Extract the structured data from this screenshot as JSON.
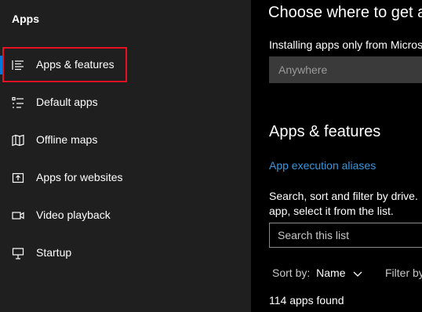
{
  "sidebar": {
    "title": "Apps",
    "items": [
      {
        "label": "Apps & features",
        "icon": "apps-features-icon",
        "selected": true
      },
      {
        "label": "Default apps",
        "icon": "default-apps-icon"
      },
      {
        "label": "Offline maps",
        "icon": "map-icon"
      },
      {
        "label": "Apps for websites",
        "icon": "external-link-icon"
      },
      {
        "label": "Video playback",
        "icon": "video-icon"
      },
      {
        "label": "Startup",
        "icon": "startup-icon"
      }
    ]
  },
  "main": {
    "choose_heading": "Choose where to get a",
    "install_text": "Installing apps only from Micros",
    "install_dropdown_value": "Anywhere",
    "section_heading": "Apps & features",
    "aliases_link": "App execution aliases",
    "description_line1": "Search, sort and filter by drive. I",
    "description_line2": "app, select it from the list.",
    "search_placeholder": "Search this list",
    "sort_label": "Sort by:",
    "sort_value": "Name",
    "filter_label": "Filter by",
    "apps_count": "114 apps found"
  },
  "colors": {
    "accent": "#0078d7",
    "link": "#3a96dd",
    "highlight": "#e81123",
    "sidebar_bg": "#1f1f1f",
    "main_bg": "#000000"
  }
}
